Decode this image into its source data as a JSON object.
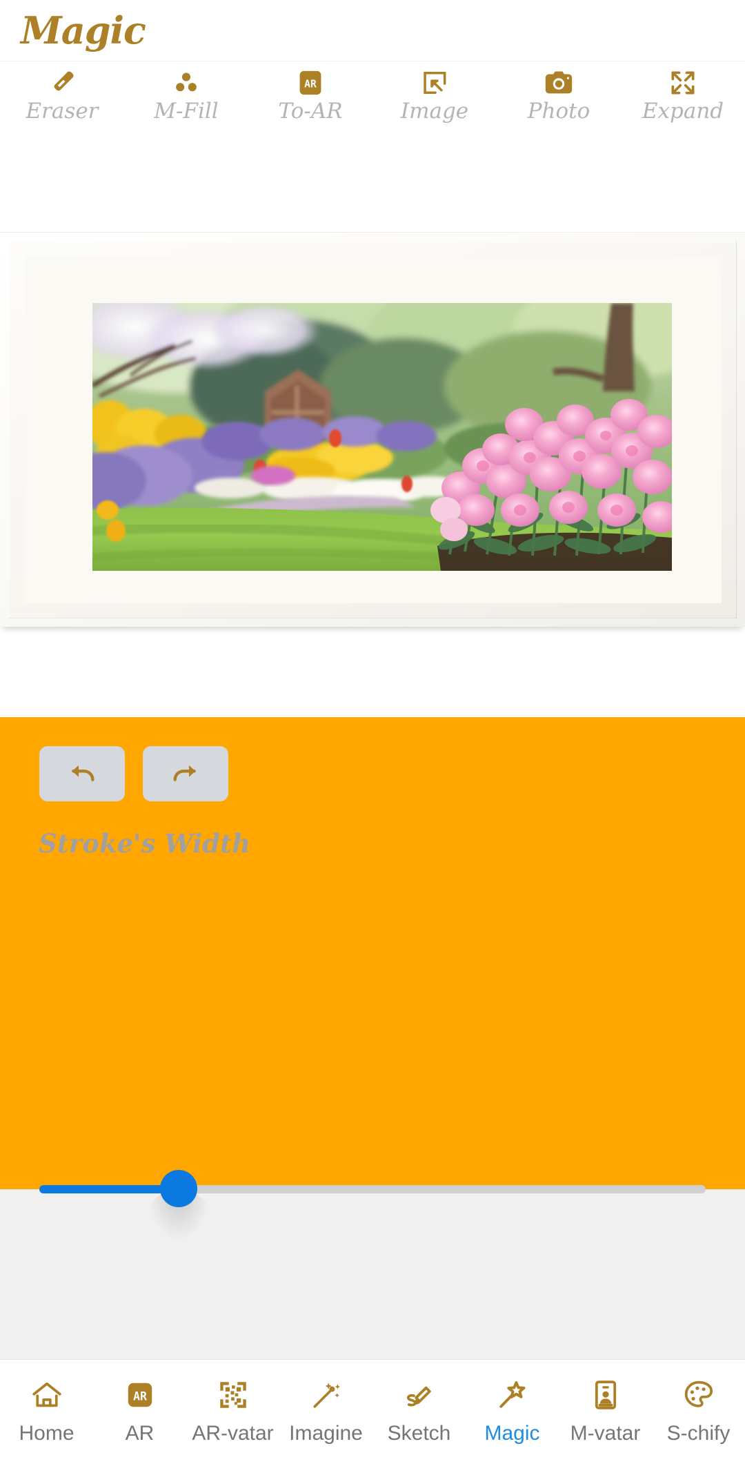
{
  "header": {
    "title": "Magic",
    "title_color": "#ab8027"
  },
  "toolbar": {
    "items": [
      {
        "label": "Eraser",
        "icon": "eraser-icon"
      },
      {
        "label": "M-Fill",
        "icon": "three-dots-fill-icon"
      },
      {
        "label": "To-AR",
        "icon": "ar-badge-icon"
      },
      {
        "label": "Image",
        "icon": "image-import-icon"
      },
      {
        "label": "Photo",
        "icon": "camera-icon"
      },
      {
        "label": "Expand",
        "icon": "expand-arrows-icon"
      }
    ],
    "label_color": "#b4b4b4",
    "icon_color": "#ab8027"
  },
  "canvas": {
    "artwork_name": "framed-garden-photo",
    "frame_style": "white-matted-frame",
    "photo_subject": "Spring garden with pink peonies, purple and yellow flower beds, blossoming trees and a wooden arbor"
  },
  "control_panel": {
    "background_color": "#FFA600",
    "undo_label": "Undo",
    "redo_label": "Redo",
    "slider": {
      "label": "Stroke's Width",
      "value_percent": 22,
      "fill_color": "#0b79e0",
      "track_color": "#d0d0d0"
    }
  },
  "bottom_nav": {
    "active": "Magic",
    "active_color": "#1f8ce6",
    "inactive_color": "#757575",
    "items": [
      {
        "label": "Home",
        "icon": "home-icon"
      },
      {
        "label": "AR",
        "icon": "ar-badge-icon"
      },
      {
        "label": "AR-vatar",
        "icon": "qr-code-icon"
      },
      {
        "label": "Imagine",
        "icon": "magic-wand-sparkle-icon"
      },
      {
        "label": "Sketch",
        "icon": "pencil-sketch-icon"
      },
      {
        "label": "Magic",
        "icon": "star-wand-icon"
      },
      {
        "label": "M-vatar",
        "icon": "id-person-card-icon"
      },
      {
        "label": "S-chify",
        "icon": "paint-palette-icon"
      }
    ]
  }
}
